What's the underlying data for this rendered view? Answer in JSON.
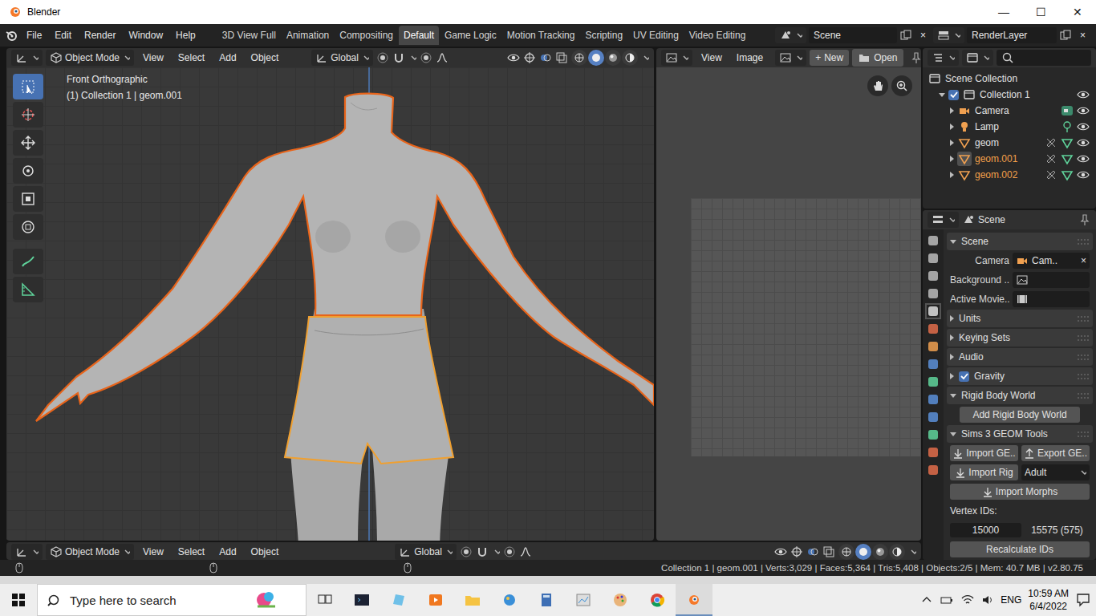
{
  "window": {
    "title": "Blender",
    "controls": [
      "—",
      "☐",
      "✕"
    ]
  },
  "menus": [
    "File",
    "Edit",
    "Render",
    "Window",
    "Help"
  ],
  "workspaces": [
    {
      "label": "3D View Full",
      "selected": false
    },
    {
      "label": "Animation",
      "selected": false
    },
    {
      "label": "Compositing",
      "selected": false
    },
    {
      "label": "Default",
      "selected": true
    },
    {
      "label": "Game Logic",
      "selected": false
    },
    {
      "label": "Motion Tracking",
      "selected": false
    },
    {
      "label": "Scripting",
      "selected": false
    },
    {
      "label": "UV Editing",
      "selected": false
    },
    {
      "label": "Video Editing",
      "selected": false
    }
  ],
  "scene": {
    "value": "Scene",
    "close": "×"
  },
  "view_layer": {
    "value": "RenderLayer",
    "close": "×"
  },
  "viewport": {
    "mode": "Object Mode",
    "menus": [
      "View",
      "Select",
      "Add",
      "Object"
    ],
    "orientation": "Global",
    "view_name": "Front Orthographic",
    "collection_info": "(1) Collection 1 | geom.001",
    "shading": [
      {
        "selected": false
      },
      {
        "selected": true
      },
      {
        "selected": false
      },
      {
        "selected": false
      }
    ]
  },
  "tools": [
    {
      "kind": "select",
      "selected": true
    },
    {
      "kind": "cursor",
      "selected": false
    },
    {
      "kind": "move",
      "selected": false
    },
    {
      "kind": "rotate",
      "selected": false
    },
    {
      "kind": "scale",
      "selected": false
    },
    {
      "kind": "transform",
      "selected": false
    },
    {
      "kind": "annotate",
      "selected": false
    },
    {
      "kind": "measure",
      "selected": false
    }
  ],
  "image_editor": {
    "menus": [
      "View",
      "Image"
    ],
    "new_icon": "+",
    "new": "New",
    "open": "Open"
  },
  "outliner": {
    "items": [
      {
        "label": "Scene Collection",
        "kind": "scene-collection",
        "selected": false,
        "active": false
      },
      {
        "label": "Collection 1",
        "kind": "collection",
        "expanded": true,
        "checked": true,
        "visible": true,
        "selected": false,
        "active": false
      },
      {
        "label": "Camera",
        "kind": "camera",
        "expanded": false,
        "visible": true,
        "selected": false,
        "active": false
      },
      {
        "label": "Lamp",
        "kind": "lamp",
        "expanded": false,
        "visible": true,
        "selected": false,
        "active": false
      },
      {
        "label": "geom",
        "kind": "mesh",
        "expanded": false,
        "visible": true,
        "selected": false,
        "active": false
      },
      {
        "label": "geom.001",
        "kind": "mesh",
        "expanded": false,
        "visible": true,
        "selected": true,
        "active": true
      },
      {
        "label": "geom.002",
        "kind": "mesh",
        "expanded": false,
        "visible": true,
        "selected": true,
        "active": false
      }
    ]
  },
  "properties": {
    "context": "Scene",
    "scene_fields": [
      {
        "label": "Camera",
        "value": "Cam..",
        "clear": "×"
      },
      {
        "label": "Background .."
      },
      {
        "label": "Active Movie.."
      }
    ],
    "panels": [
      {
        "kind": "scene",
        "title": "Scene",
        "expanded": true
      },
      {
        "kind": "plain",
        "title": "Units",
        "expanded": false
      },
      {
        "kind": "plain",
        "title": "Keying Sets",
        "expanded": false
      },
      {
        "kind": "plain",
        "title": "Audio",
        "expanded": false
      },
      {
        "kind": "checkbox",
        "title": "Gravity",
        "expanded": false,
        "checked": true
      },
      {
        "kind": "rigid",
        "title": "Rigid Body World",
        "expanded": true
      },
      {
        "kind": "sims",
        "title": "Sims 3 GEOM Tools",
        "expanded": true
      }
    ],
    "rigid_button": "Add Rigid Body World",
    "sims": {
      "import_geom": "Import GE..",
      "export_geom": "Export GE..",
      "import_rig": "Import Rig",
      "rig_type": "Adult",
      "import_morphs": "Import Morphs",
      "vertex_ids_label": "Vertex IDs:",
      "vertex_start": "15000",
      "vertex_range": "15575 (575)",
      "recalculate": "Recalculate IDs"
    }
  },
  "timeline": {
    "mode": "Object Mode",
    "menus": [
      "View",
      "Select",
      "Add",
      "Object"
    ],
    "orientation": "Global"
  },
  "status_bar": {
    "text": "Collection 1 | geom.001 | Verts:3,029 | Faces:5,364 | Tris:5,408 | Objects:2/5 | Mem: 40.7 MB | v2.80.75"
  },
  "taskbar": {
    "search_placeholder": "Type here to search",
    "language": "ENG",
    "time": "10:59 AM",
    "date": "6/4/2022"
  }
}
